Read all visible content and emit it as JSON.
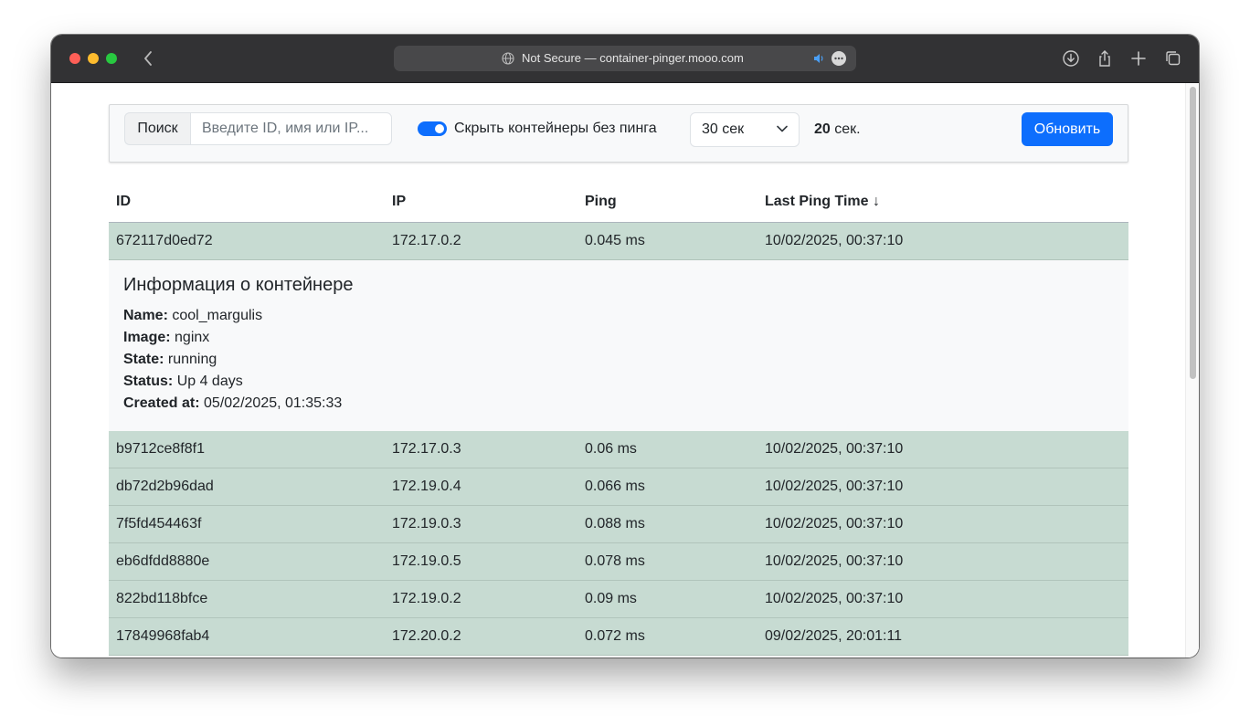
{
  "browser": {
    "address": "Not Secure — container-pinger.mooo.com"
  },
  "toolbar": {
    "search_label": "Поиск",
    "search_placeholder": "Введите ID, имя или IP...",
    "search_value": "",
    "hide_toggle_on": true,
    "hide_toggle_label": "Скрыть контейнеры без пинга",
    "interval_selected": "30 сек",
    "countdown_value": "20",
    "countdown_unit": "сек.",
    "refresh_label": "Обновить",
    "accent_color": "#0d6efd"
  },
  "table": {
    "headers": {
      "id": "ID",
      "ip": "IP",
      "ping": "Ping",
      "last_ping_time": "Last Ping Time ↓"
    },
    "row_color": "#c7dbd2",
    "rows": [
      {
        "id": "672117d0ed72",
        "ip": "172.17.0.2",
        "ping": "0.045 ms",
        "time": "10/02/2025, 00:37:10"
      },
      {
        "id": "b9712ce8f8f1",
        "ip": "172.17.0.3",
        "ping": "0.06 ms",
        "time": "10/02/2025, 00:37:10"
      },
      {
        "id": "db72d2b96dad",
        "ip": "172.19.0.4",
        "ping": "0.066 ms",
        "time": "10/02/2025, 00:37:10"
      },
      {
        "id": "7f5fd454463f",
        "ip": "172.19.0.3",
        "ping": "0.088 ms",
        "time": "10/02/2025, 00:37:10"
      },
      {
        "id": "eb6dfdd8880e",
        "ip": "172.19.0.5",
        "ping": "0.078 ms",
        "time": "10/02/2025, 00:37:10"
      },
      {
        "id": "822bd118bfce",
        "ip": "172.19.0.2",
        "ping": "0.09 ms",
        "time": "10/02/2025, 00:37:10"
      },
      {
        "id": "17849968fab4",
        "ip": "172.20.0.2",
        "ping": "0.072 ms",
        "time": "09/02/2025, 20:01:11"
      }
    ]
  },
  "details": {
    "title": "Информация о контейнере",
    "name_label": "Name:",
    "name": "cool_margulis",
    "image_label": "Image:",
    "image": "nginx",
    "state_label": "State:",
    "state": "running",
    "status_label": "Status:",
    "status": "Up 4 days",
    "created_label": "Created at:",
    "created": "05/02/2025, 01:35:33"
  }
}
